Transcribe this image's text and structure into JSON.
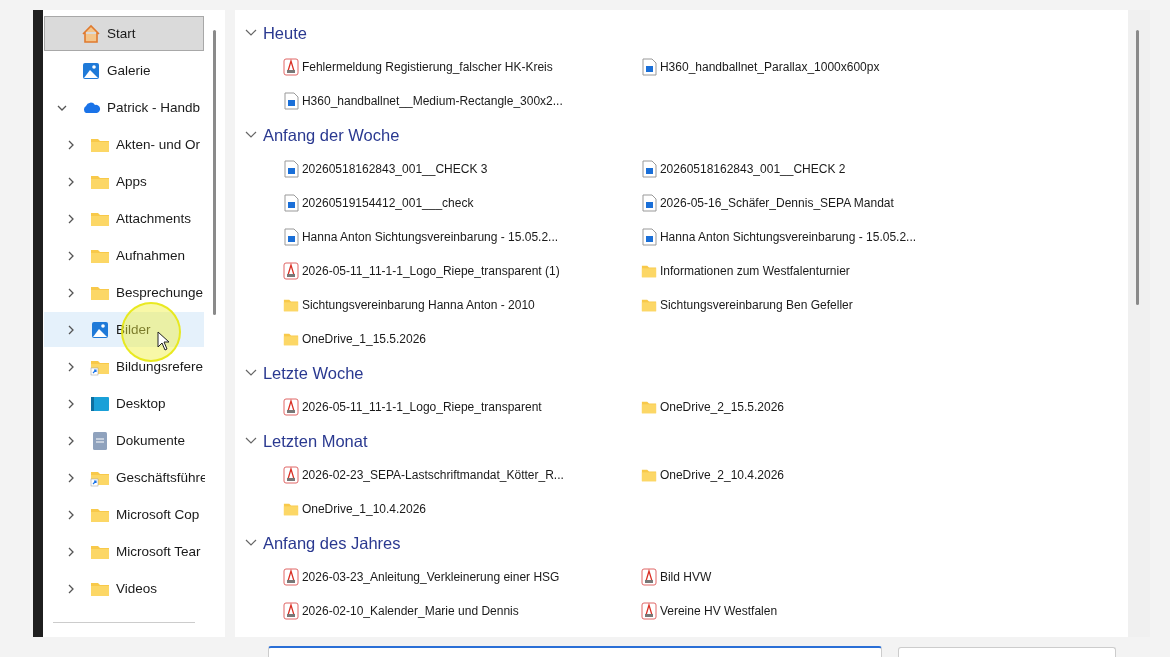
{
  "sidebar": {
    "items": [
      {
        "label": "Start",
        "kind": "home",
        "selected": true,
        "hovered": false
      },
      {
        "label": "Galerie",
        "kind": "gallery",
        "selected": false,
        "hovered": false
      },
      {
        "label": "Patrick - Handb",
        "kind": "cloud",
        "selected": false,
        "hovered": false,
        "expanded": true,
        "children": [
          {
            "label": "Akten- und Or",
            "kind": "folder",
            "selected": false,
            "hovered": false,
            "expanded": false
          },
          {
            "label": "Apps",
            "kind": "folder",
            "selected": false,
            "hovered": false,
            "expanded": false
          },
          {
            "label": "Attachments",
            "kind": "folder",
            "selected": false,
            "hovered": false,
            "expanded": false
          },
          {
            "label": "Aufnahmen",
            "kind": "folder",
            "selected": false,
            "hovered": false,
            "expanded": false
          },
          {
            "label": "Besprechunge",
            "kind": "folder",
            "selected": false,
            "hovered": false,
            "expanded": false
          },
          {
            "label": "Bilder",
            "kind": "pictures",
            "selected": false,
            "hovered": true,
            "expanded": false
          },
          {
            "label": "Bildungsrefere",
            "kind": "shortcut",
            "selected": false,
            "hovered": false,
            "expanded": false
          },
          {
            "label": "Desktop",
            "kind": "desktop",
            "selected": false,
            "hovered": false,
            "expanded": false
          },
          {
            "label": "Dokumente",
            "kind": "documents",
            "selected": false,
            "hovered": false,
            "expanded": false
          },
          {
            "label": "Geschäftsführe",
            "kind": "shortcut",
            "selected": false,
            "hovered": false,
            "expanded": false
          },
          {
            "label": "Microsoft Cop",
            "kind": "folder",
            "selected": false,
            "hovered": false,
            "expanded": false
          },
          {
            "label": "Microsoft Tear",
            "kind": "folder",
            "selected": false,
            "hovered": false,
            "expanded": false
          },
          {
            "label": "Videos",
            "kind": "folder",
            "selected": false,
            "hovered": false,
            "expanded": false
          }
        ]
      }
    ]
  },
  "groups": [
    {
      "title": "Heute",
      "expanded": true,
      "files": [
        {
          "name": "Fehlermeldung Registierung_falscher HK-Kreis",
          "kind": "pdf"
        },
        {
          "name": "H360_handballnet_Parallax_1000x600px",
          "kind": "image"
        },
        {
          "name": "H360_handballnet__Medium-Rectangle_300x2...",
          "kind": "image"
        }
      ]
    },
    {
      "title": "Anfang der Woche",
      "expanded": true,
      "files": [
        {
          "name": "20260518162843_001__CHECK 3",
          "kind": "image"
        },
        {
          "name": "20260518162843_001__CHECK 2",
          "kind": "image"
        },
        {
          "name": "20260519154412_001___check",
          "kind": "image"
        },
        {
          "name": "2026-05-16_Schäfer_Dennis_SEPA Mandat",
          "kind": "image"
        },
        {
          "name": "Hanna Anton Sichtungsvereinbarung - 15.05.2...",
          "kind": "image"
        },
        {
          "name": "Hanna Anton Sichtungsvereinbarung - 15.05.2...",
          "kind": "image"
        },
        {
          "name": "2026-05-11_11-1-1_Logo_Riepe_transparent (1)",
          "kind": "pdf"
        },
        {
          "name": "Informationen zum Westfalenturnier",
          "kind": "folder"
        },
        {
          "name": "Sichtungsvereinbarung Hanna Anton - 2010",
          "kind": "folder"
        },
        {
          "name": "Sichtungsvereinbarung Ben Gefeller",
          "kind": "folder"
        },
        {
          "name": "OneDrive_1_15.5.2026",
          "kind": "folder"
        }
      ]
    },
    {
      "title": "Letzte Woche",
      "expanded": true,
      "files": [
        {
          "name": "2026-05-11_11-1-1_Logo_Riepe_transparent",
          "kind": "pdf"
        },
        {
          "name": "OneDrive_2_15.5.2026",
          "kind": "folder"
        }
      ]
    },
    {
      "title": "Letzten Monat",
      "expanded": true,
      "files": [
        {
          "name": "2026-02-23_SEPA-Lastschriftmandat_Kötter_R...",
          "kind": "pdf"
        },
        {
          "name": "OneDrive_2_10.4.2026",
          "kind": "folder"
        },
        {
          "name": "OneDrive_1_10.4.2026",
          "kind": "folder"
        }
      ]
    },
    {
      "title": "Anfang des Jahres",
      "expanded": true,
      "files": [
        {
          "name": "2026-03-23_Anleitung_Verkleinerung einer HSG",
          "kind": "pdf"
        },
        {
          "name": "Bild HVW",
          "kind": "pdf"
        },
        {
          "name": "2026-02-10_Kalender_Marie und Dennis",
          "kind": "pdf"
        },
        {
          "name": "Vereine HV Westfalen",
          "kind": "pdf"
        }
      ]
    }
  ]
}
